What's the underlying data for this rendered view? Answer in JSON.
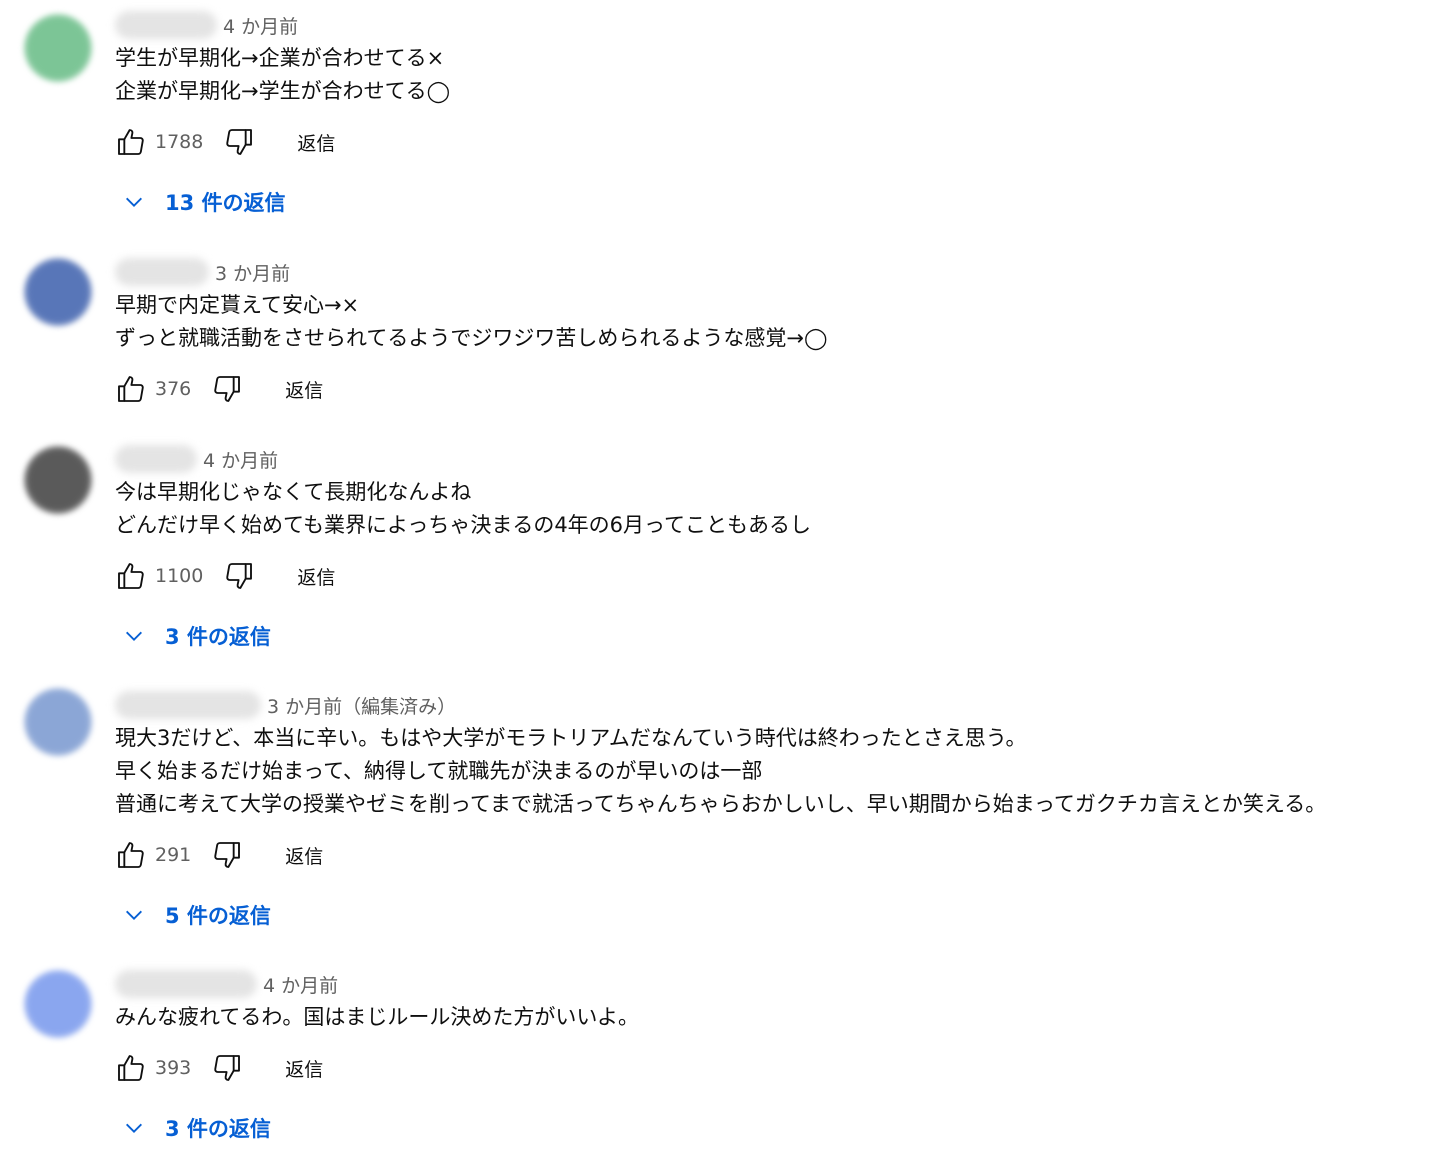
{
  "colors": {
    "link": "#065fd4",
    "meta": "#606060",
    "text": "#0f0f0f"
  },
  "comments": [
    {
      "avatar_color": "#7cc596",
      "time": "4 か月前",
      "lines": [
        "学生が早期化→企業が合わせてる×",
        "企業が早期化→学生が合わせてる◯"
      ],
      "likes": "1788",
      "reply_label": "返信",
      "replies_label": "13 件の返信"
    },
    {
      "avatar_color": "#5876b8",
      "time": "3 か月前",
      "lines": [
        "早期で内定貰えて安心→×",
        "ずっと就職活動をさせられてるようでジワジワ苦しめられるような感覚→◯"
      ],
      "likes": "376",
      "reply_label": "返信"
    },
    {
      "avatar_color": "#5a5a5a",
      "time": "4 か月前",
      "lines": [
        "今は早期化じゃなくて長期化なんよね",
        "どんだけ早く始めても業界によっちゃ決まるの4年の6月ってこともあるし"
      ],
      "likes": "1100",
      "reply_label": "返信",
      "replies_label": "3 件の返信"
    },
    {
      "avatar_color": "#8ba6d6",
      "time": "3 か月前（編集済み）",
      "lines": [
        "現大3だけど、本当に辛い。もはや大学がモラトリアムだなんていう時代は終わったとさえ思う。",
        "早く始まるだけ始まって、納得して就職先が決まるのが早いのは一部",
        "普通に考えて大学の授業やゼミを削ってまで就活ってちゃんちゃらおかしいし、早い期間から始まってガクチカ言えとか笑える。"
      ],
      "likes": "291",
      "reply_label": "返信",
      "replies_label": "5 件の返信"
    },
    {
      "avatar_color": "#8aa6ef",
      "time": "4 か月前",
      "lines": [
        "みんな疲れてるわ。国はまじルール決めた方がいいよ。"
      ],
      "likes": "393",
      "reply_label": "返信",
      "replies_label": "3 件の返信"
    }
  ]
}
